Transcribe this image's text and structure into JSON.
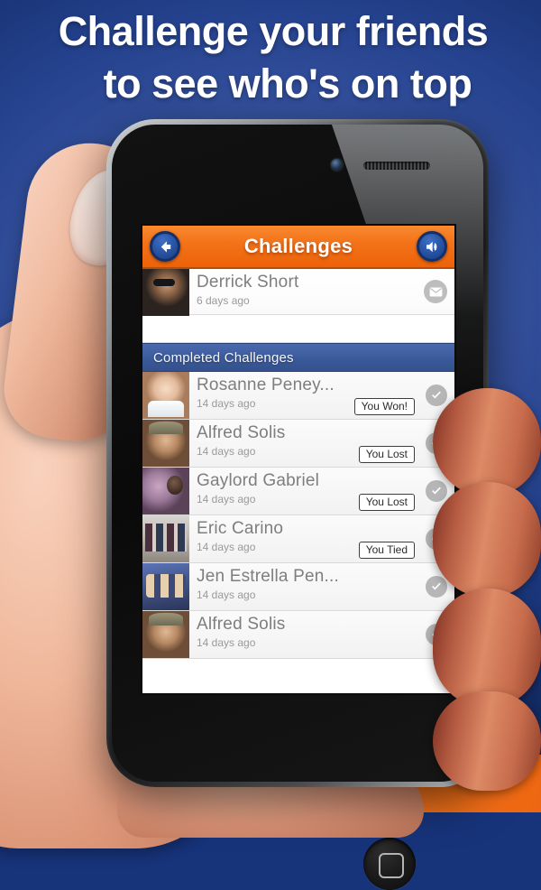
{
  "promo": {
    "headline_line1": "Challenge your friends",
    "headline_line2": "to see who's on top",
    "bg_color": "#2b4896",
    "accent_orange": "#f4731a",
    "accent_blue": "#3b5a9a"
  },
  "app": {
    "header": {
      "title": "Challenges",
      "back_icon": "back-arrow-icon",
      "sound_icon": "speaker-icon",
      "bar_color": "#f4731a"
    },
    "pending": {
      "name": "Derrick Short",
      "time": "6 days ago",
      "action_icon": "envelope-icon"
    },
    "section_title": "Completed Challenges",
    "completed": [
      {
        "name": "Rosanne Peney...",
        "time": "14 days ago",
        "result": "You Won!",
        "status_icon": "check-circle-icon",
        "photo": "ph-baby"
      },
      {
        "name": "Alfred Solis",
        "time": "14 days ago",
        "result": "You Lost",
        "status_icon": "check-circle-icon",
        "photo": "ph-alfred"
      },
      {
        "name": "Gaylord Gabriel",
        "time": "14 days ago",
        "result": "You Lost",
        "status_icon": "check-circle-icon",
        "photo": "ph-gaylord"
      },
      {
        "name": "Eric Carino",
        "time": "14 days ago",
        "result": "You Tied",
        "status_icon": "check-circle-icon",
        "photo": "ph-eric"
      },
      {
        "name": "Jen Estrella Pen...",
        "time": "14 days ago",
        "result": "",
        "status_icon": "check-circle-icon",
        "photo": "ph-jen"
      },
      {
        "name": "Alfred Solis",
        "time": "14 days ago",
        "result": "",
        "status_icon": "check-circle-icon",
        "photo": "ph-alfred"
      }
    ]
  },
  "device": {
    "home_button": "home-button",
    "camera": "front-camera",
    "speaker": "earpiece-speaker"
  }
}
